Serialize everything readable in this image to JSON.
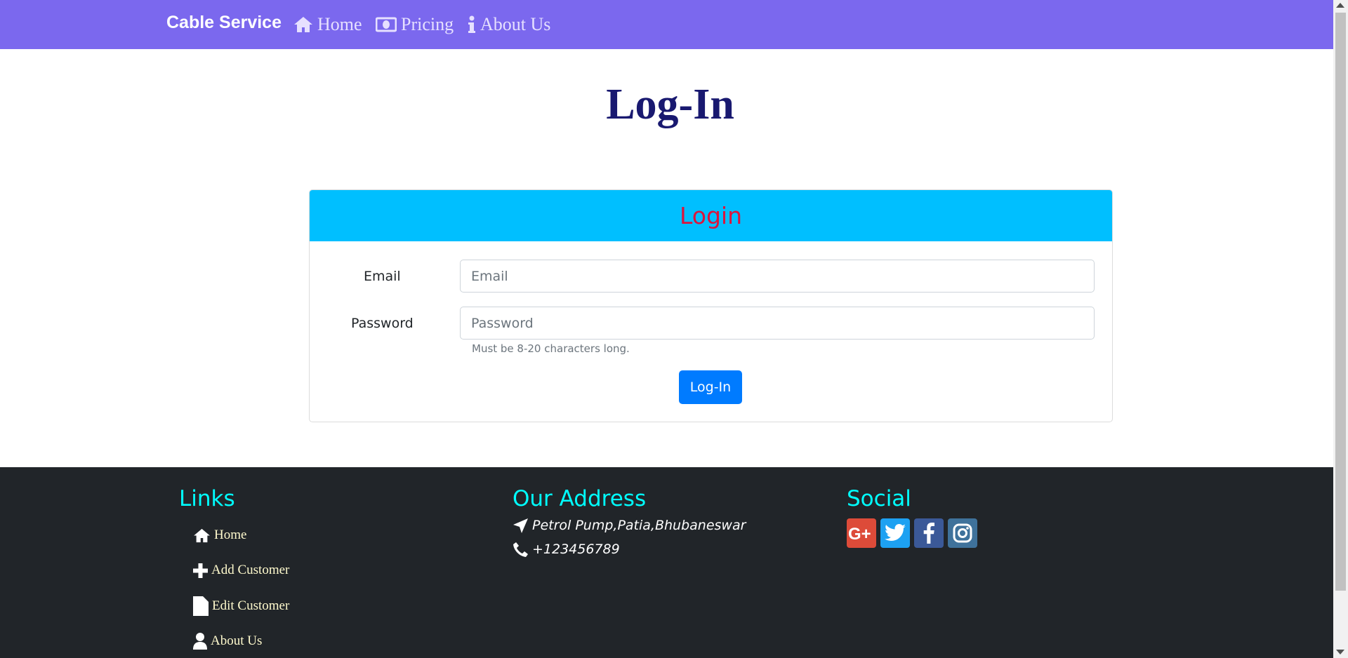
{
  "navbar": {
    "brand": "Cable Service",
    "items": [
      {
        "label": "Home",
        "icon": "home-icon"
      },
      {
        "label": "Pricing",
        "icon": "money-icon"
      },
      {
        "label": "About Us",
        "icon": "info-icon"
      }
    ],
    "background": "#7b68ee"
  },
  "page": {
    "title": "Log-In"
  },
  "login_card": {
    "title": "Login",
    "email_label": "Email",
    "email_placeholder": "Email",
    "email_value": "",
    "password_label": "Password",
    "password_placeholder": "Password",
    "password_value": "",
    "password_help": "Must be 8-20 characters long.",
    "submit_label": "Log-In",
    "header_color": "#00bfff",
    "title_color": "#dc143c",
    "button_color": "#007bff"
  },
  "footer": {
    "links_heading": "Links",
    "links": [
      {
        "label": "Home",
        "icon": "home-icon"
      },
      {
        "label": "Add Customer",
        "icon": "plus-icon"
      },
      {
        "label": "Edit Customer",
        "icon": "file-icon"
      },
      {
        "label": "About Us",
        "icon": "user-icon"
      }
    ],
    "address_heading": "Our Address",
    "address": "Petrol Pump,Patia,Bhubaneswar",
    "phone": "+123456789",
    "social_heading": "Social",
    "social": [
      {
        "icon": "google-plus-icon",
        "color": "#dd4b39"
      },
      {
        "icon": "twitter-icon",
        "color": "#1da1f2"
      },
      {
        "icon": "facebook-icon",
        "color": "#3b5998"
      },
      {
        "icon": "instagram-icon",
        "color": "#3f729b"
      }
    ],
    "background": "#212529",
    "heading_color": "#00ffff"
  }
}
